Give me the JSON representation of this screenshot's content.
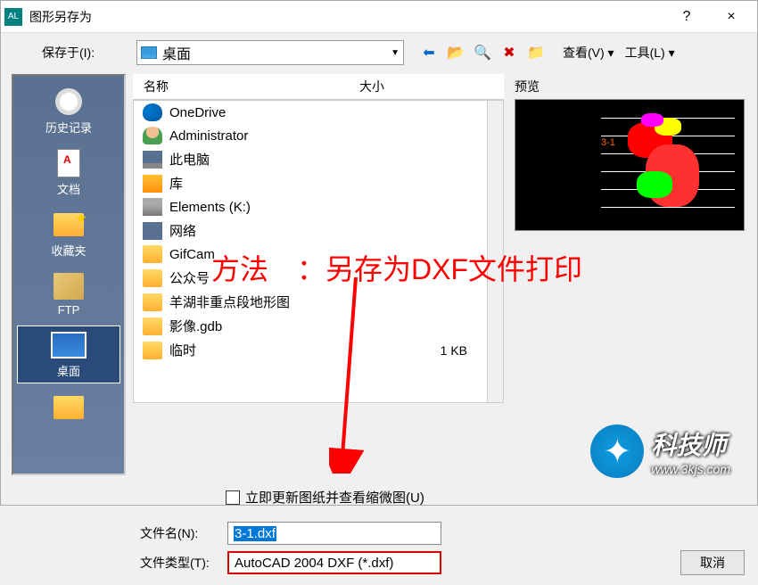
{
  "window": {
    "title": "图形另存为",
    "help": "?",
    "close": "×"
  },
  "save_in": {
    "label": "保存于(I):",
    "location": "桌面",
    "view_label": "查看(V)",
    "tools_label": "工具(L)"
  },
  "left_panel": [
    {
      "label": "历史记录"
    },
    {
      "label": "文档"
    },
    {
      "label": "收藏夹"
    },
    {
      "label": "FTP"
    },
    {
      "label": "桌面"
    }
  ],
  "columns": {
    "name": "名称",
    "size": "大小"
  },
  "files": [
    {
      "name": "OneDrive",
      "icon": "onedrive"
    },
    {
      "name": "Administrator",
      "icon": "user"
    },
    {
      "name": "此电脑",
      "icon": "pc"
    },
    {
      "name": "库",
      "icon": "lib"
    },
    {
      "name": "Elements (K:)",
      "icon": "drive"
    },
    {
      "name": "网络",
      "icon": "net"
    },
    {
      "name": "GifCam",
      "icon": "folder"
    },
    {
      "name": "公众号",
      "icon": "folder"
    },
    {
      "name": "羊湖非重点段地形图",
      "icon": "folder"
    },
    {
      "name": "影像.gdb",
      "icon": "folder"
    },
    {
      "name": "临时",
      "icon": "folder",
      "size": "1 KB"
    }
  ],
  "preview": {
    "label": "预览"
  },
  "checkbox": {
    "label": "立即更新图纸并查看缩微图(U)"
  },
  "filename": {
    "label": "文件名(N):",
    "value": "3-1.dxf"
  },
  "filetype": {
    "label": "文件类型(T):",
    "value": "AutoCAD 2004 DXF (*.dxf)"
  },
  "buttons": {
    "cancel": "取消"
  },
  "annotation": {
    "text": "方法　：另存为DXF文件打印"
  },
  "watermark": {
    "main": "科技师",
    "sub": "www.3kjs.com"
  }
}
